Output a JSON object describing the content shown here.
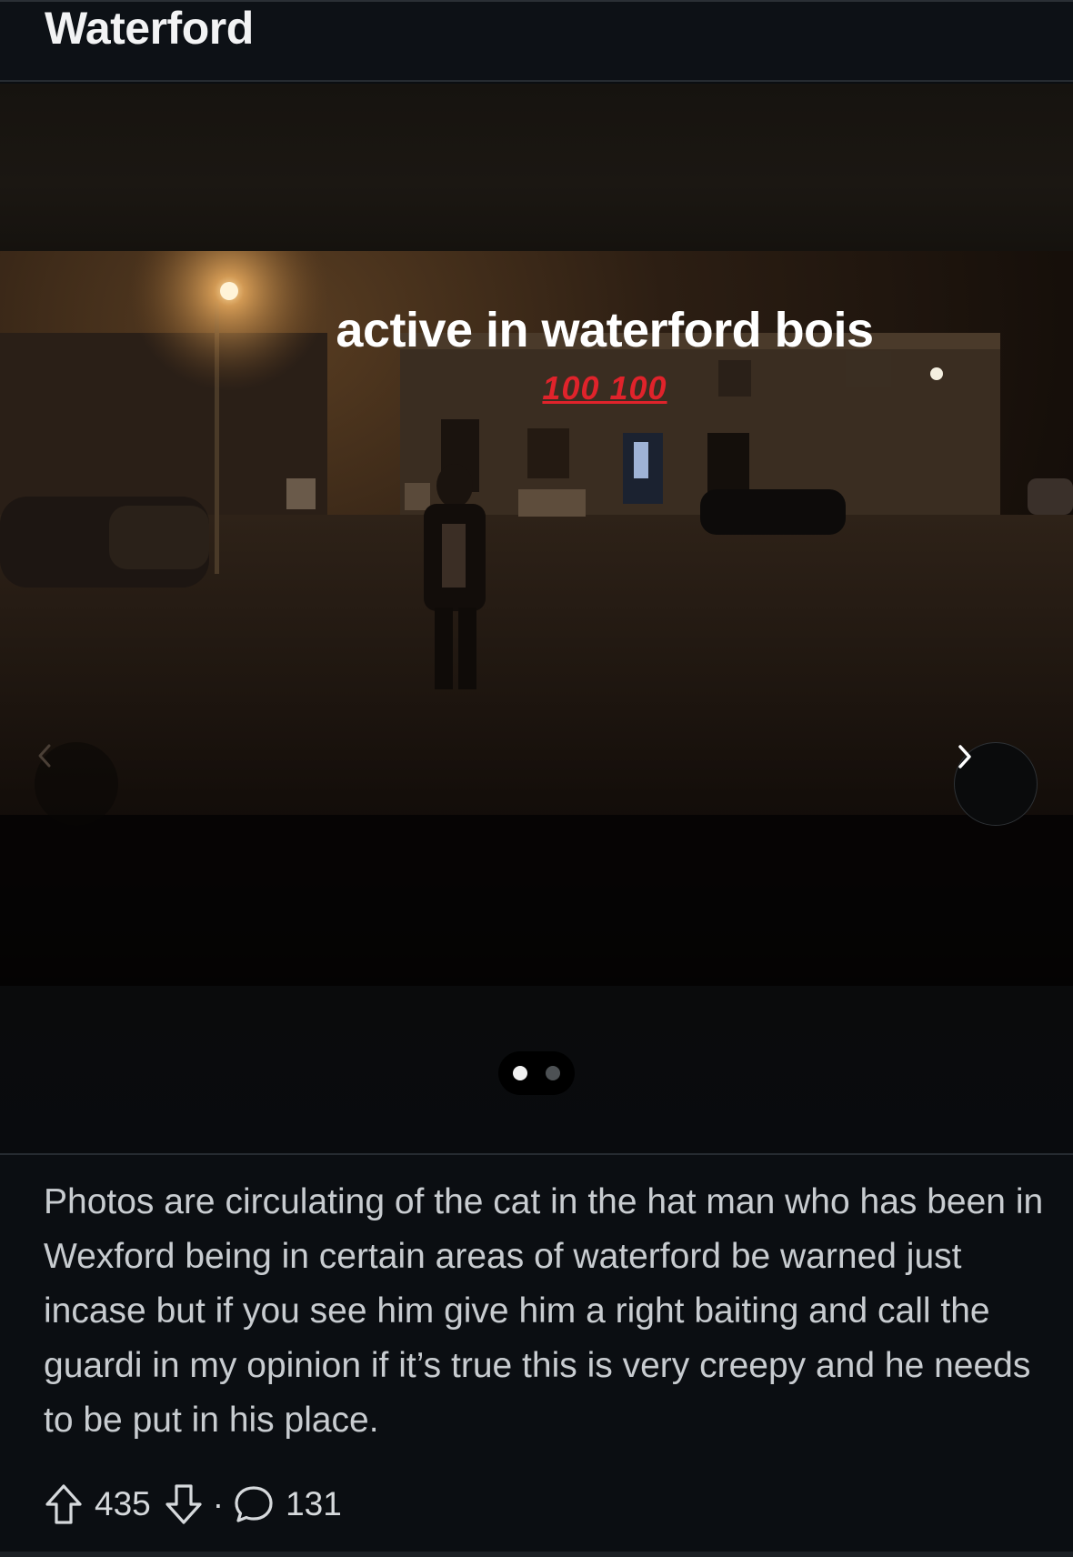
{
  "header": {
    "title": "Waterford"
  },
  "media": {
    "caption": "active in waterford bois",
    "emoji_text": "100 100",
    "pagination": {
      "current": 1,
      "total": 2
    },
    "prev_icon": "chevron-left-icon",
    "next_icon": "chevron-right-icon"
  },
  "post": {
    "body": "Photos are circulating of the cat in the hat man who has been in Wexford being in certain areas of waterford be warned just incase but if you see him give him a right baiting and call the guardi in my opinion if it’s true this is very creepy and he needs to be put in his place."
  },
  "actions": {
    "upvotes": "435",
    "separator": "·",
    "comments": "131",
    "upvote_icon": "arrow-up-icon",
    "downvote_icon": "arrow-down-icon",
    "comment_icon": "speech-bubble-icon"
  }
}
